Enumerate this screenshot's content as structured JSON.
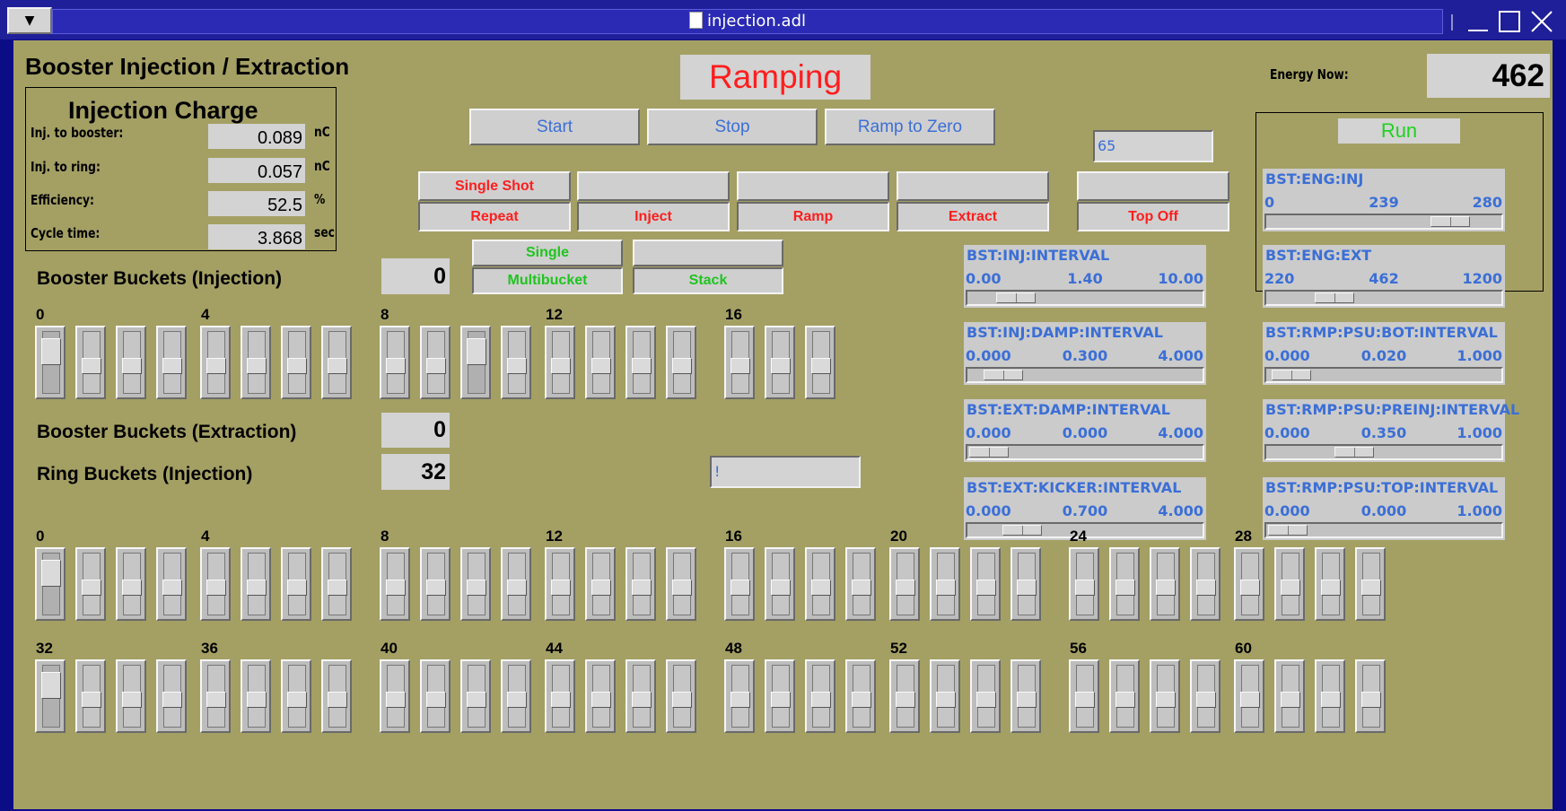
{
  "window": {
    "title": "injection.adl",
    "menu_glyph": "▼"
  },
  "header": {
    "title": "Booster Injection / Extraction",
    "status": "Ramping",
    "status_color": "#ff1e1e",
    "energy_label": "Energy Now:",
    "energy_value": "462"
  },
  "charge": {
    "title": "Injection Charge",
    "rows": [
      {
        "label": "Inj. to booster:",
        "value": "0.089",
        "unit": "nC"
      },
      {
        "label": "Inj. to ring:",
        "value": "0.057",
        "unit": "nC"
      },
      {
        "label": "Efficiency:",
        "value": "52.5",
        "unit": "%"
      },
      {
        "label": "Cycle time:",
        "value": "3.868",
        "unit": "sec"
      }
    ]
  },
  "ramp_buttons": {
    "start": "Start",
    "stop": "Stop",
    "ramp_to_zero": "Ramp to Zero",
    "entry_value": "65"
  },
  "mode_buttons": {
    "top": [
      "Single Shot",
      "",
      "",
      "",
      ""
    ],
    "bottom": [
      "Repeat",
      "Inject",
      "Ramp",
      "Extract",
      "Top Off"
    ]
  },
  "bucket_mode": {
    "top_left": "Single",
    "top_right": "",
    "bottom_left": "Multibucket",
    "bottom_right": "Stack"
  },
  "run": {
    "label": "Run",
    "color": "#1fd21f"
  },
  "sliders": [
    {
      "title": "BST:ENG:INJ",
      "lo": "0",
      "mid": "239",
      "hi": "280",
      "frac": 0.854
    },
    {
      "title": "BST:ENG:EXT",
      "lo": "220",
      "mid": "462",
      "hi": "1200",
      "frac": 0.247
    },
    {
      "title": "BST:INJ:INTERVAL",
      "lo": "0.00",
      "mid": "1.40",
      "hi": "10.00",
      "frac": 0.14
    },
    {
      "title": "BST:INJ:DAMP:INTERVAL",
      "lo": "0.000",
      "mid": "0.300",
      "hi": "4.000",
      "frac": 0.075
    },
    {
      "title": "BST:RMP:PSU:BOT:INTERVAL",
      "lo": "0.000",
      "mid": "0.020",
      "hi": "1.000",
      "frac": 0.02
    },
    {
      "title": "BST:EXT:DAMP:INTERVAL",
      "lo": "0.000",
      "mid": "0.000",
      "hi": "4.000",
      "frac": 0.0
    },
    {
      "title": "BST:RMP:PSU:PREINJ:INTERVAL",
      "lo": "0.000",
      "mid": "0.350",
      "hi": "1.000",
      "frac": 0.35
    },
    {
      "title": "BST:EXT:KICKER:INTERVAL",
      "lo": "0.000",
      "mid": "0.700",
      "hi": "4.000",
      "frac": 0.175
    },
    {
      "title": "BST:RMP:PSU:TOP:INTERVAL",
      "lo": "0.000",
      "mid": "0.000",
      "hi": "1.000",
      "frac": 0.0
    }
  ],
  "booster_inj": {
    "label": "Booster Buckets (Injection)",
    "value": "0",
    "group_labels": [
      "0",
      "4",
      "8",
      "12",
      "16"
    ],
    "on": [
      0,
      10
    ]
  },
  "booster_ext": {
    "label": "Booster Buckets (Extraction)",
    "value": "0"
  },
  "ring_inj": {
    "label": "Ring Buckets (Injection)",
    "value": "32",
    "entry_value": "!",
    "row1_labels": [
      "0",
      "4",
      "8",
      "12",
      "16",
      "20",
      "24",
      "28"
    ],
    "row2_labels": [
      "32",
      "36",
      "40",
      "44",
      "48",
      "52",
      "56",
      "60"
    ],
    "on": [
      0,
      32
    ]
  }
}
